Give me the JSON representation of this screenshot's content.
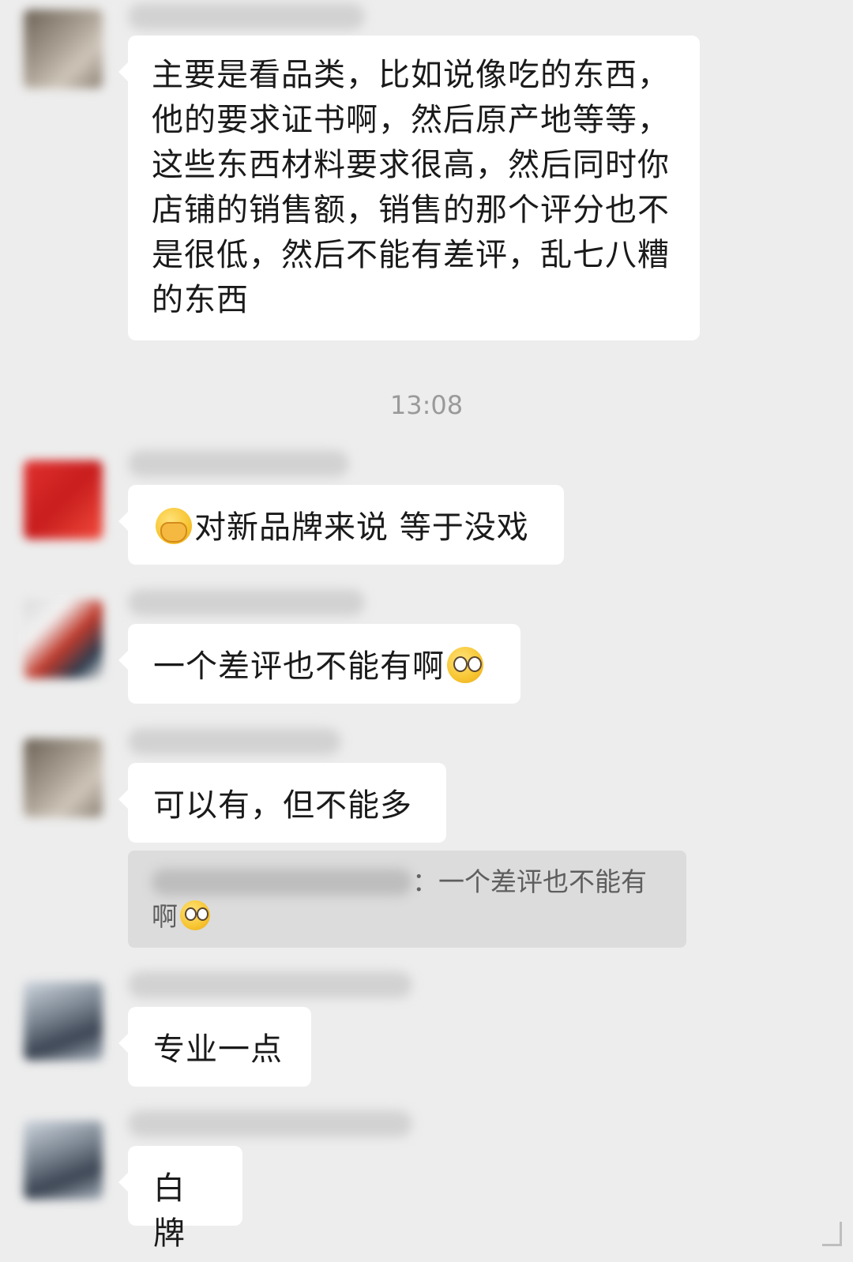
{
  "chat": {
    "timestamp": "13:08",
    "messages": [
      {
        "text": "主要是看品类，比如说像吃的东西，他的要求证书啊，然后原产地等等，这些东西材料要求很高，然后同时你店铺的销售额，销售的那个评分也不是很低，然后不能有差评，乱七八糟的东西"
      },
      {
        "emoji": "facepalm-emoji",
        "text": "对新品牌来说 等于没戏"
      },
      {
        "text": "一个差评也不能有啊",
        "emoji": "rolling-eyes-emoji"
      },
      {
        "text": "可以有，但不能多"
      },
      {
        "text": "专业一点"
      },
      {
        "text": "白牌"
      }
    ],
    "quote": {
      "separator": "：",
      "text": "一个差评也不能有啊",
      "emoji": "rolling-eyes-emoji"
    }
  }
}
